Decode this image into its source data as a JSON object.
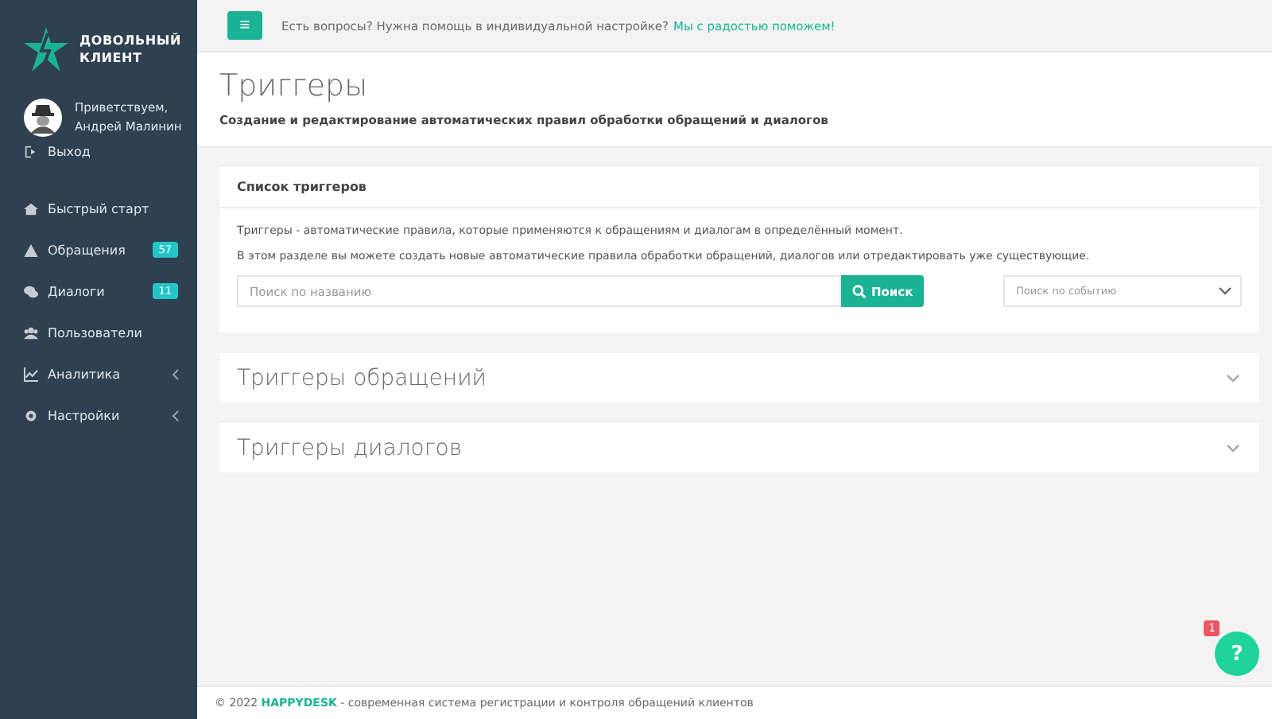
{
  "sidebar": {
    "logo": [
      "ДОВОЛЬНЫЙ",
      "КЛИЕНТ"
    ],
    "greeting": "Приветствуем,",
    "user": "Андрей Малинин",
    "logout": "Выход",
    "items": [
      {
        "label": "Быстрый старт",
        "expandable": false
      },
      {
        "label": "Обращения",
        "badge": "57",
        "expandable": false
      },
      {
        "label": "Диалоги",
        "badge": "11",
        "expandable": false
      },
      {
        "label": "Пользователи",
        "expandable": false
      },
      {
        "label": "Аналитика",
        "expandable": true
      },
      {
        "label": "Настройки",
        "expandable": true
      }
    ]
  },
  "topbar": {
    "menu_button": "≡",
    "question": "Есть вопросы? Нужна помощь в индивидуальной настройке?",
    "link": "Мы с радостью поможем!"
  },
  "header": {
    "title": "Триггеры",
    "subtitle": "Создание и редактирование автоматических правил обработки обращений и диалогов"
  },
  "list_card": {
    "title": "Список триггеров",
    "paragraphs": [
      "Триггеры - автоматические правила, которые применяются к обращениям и диалогам в определённый момент.",
      "В этом разделе вы можете создать новые автоматические правила обработки обращений, диалогов или отредактировать уже существующие."
    ],
    "search": {
      "placeholder": "Поиск по названию"
    },
    "search_button": "Поиск",
    "event_select": {
      "placeholder": "Поиск по событию"
    }
  },
  "sections": [
    {
      "title": "Триггеры обращений",
      "expanded": false
    },
    {
      "title": "Триггеры диалогов",
      "expanded": false
    }
  ],
  "help": {
    "label": "?",
    "badge": "1"
  },
  "footer": "© 2022 **HAPPYDESK** - современная система регистрации и контроля обращений клиентов"
}
